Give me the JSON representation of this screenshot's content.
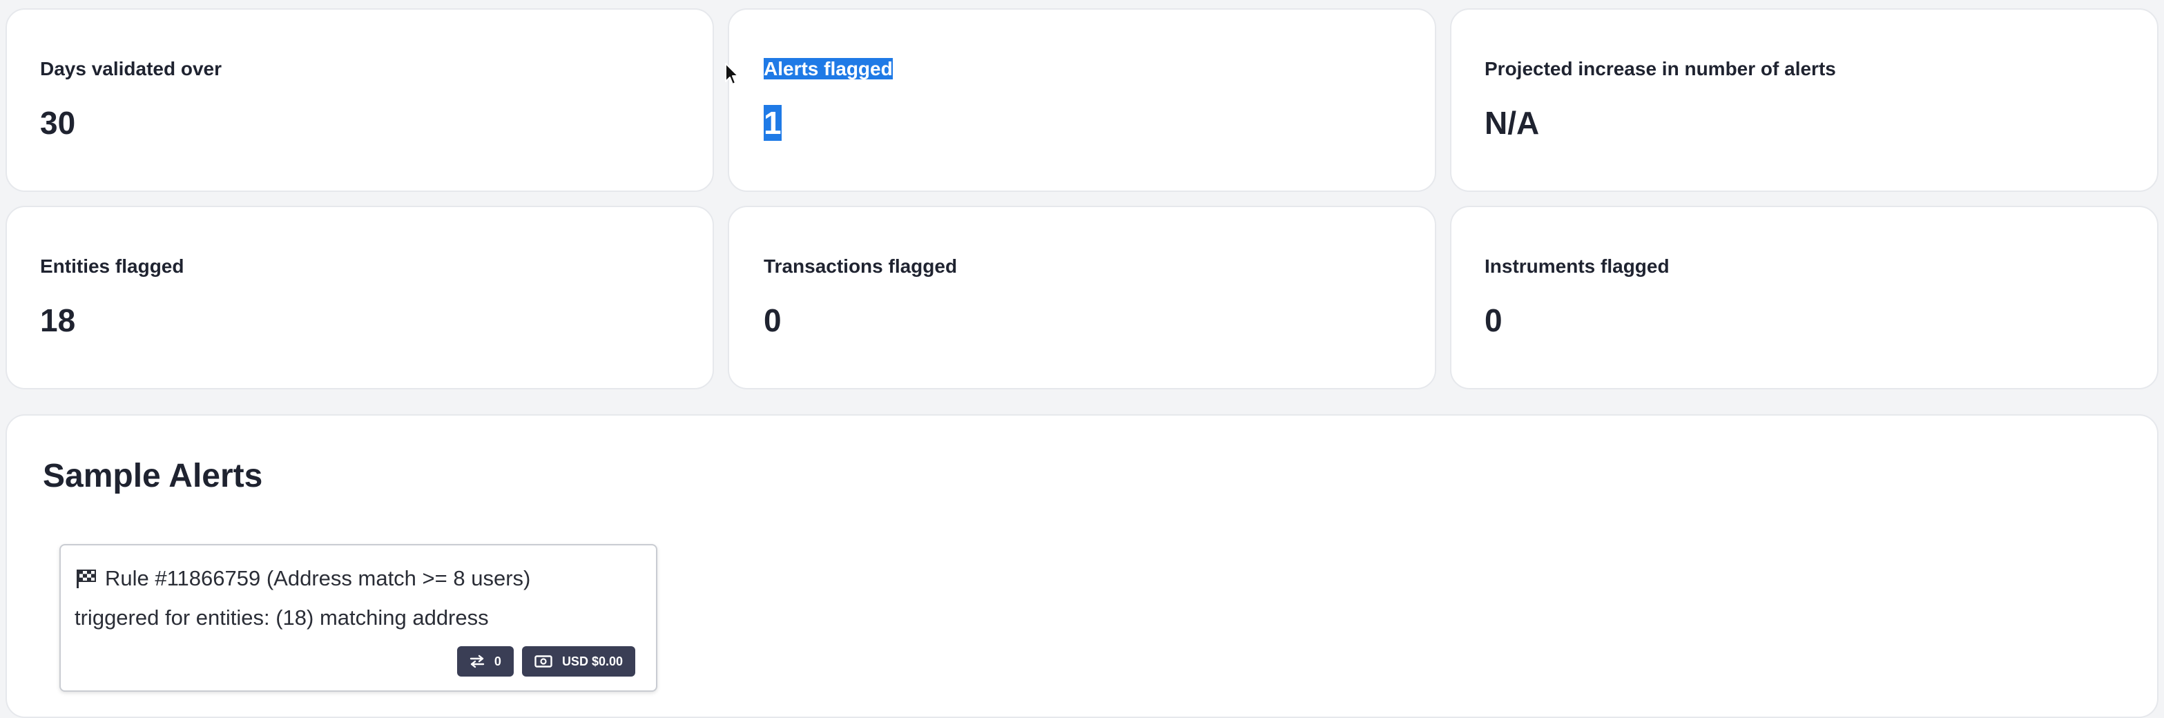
{
  "stats": [
    {
      "label": "Days validated over",
      "value": "30"
    },
    {
      "label": "Alerts flagged",
      "value": "1"
    },
    {
      "label": "Projected increase in number of alerts",
      "value": "N/A"
    },
    {
      "label": "Entities flagged",
      "value": "18"
    },
    {
      "label": "Transactions flagged",
      "value": "0"
    },
    {
      "label": "Instruments flagged",
      "value": "0"
    }
  ],
  "sample_alerts": {
    "title": "Sample Alerts",
    "alerts": [
      {
        "icon": "checkered-flag-icon",
        "rule_text": "Rule #11866759 (Address match >= 8 users)",
        "trigger_text": "triggered for entities: (18) matching address",
        "transfer_count": "0",
        "amount": "USD $0.00"
      }
    ]
  },
  "colors": {
    "background": "#f3f4f6",
    "card": "#ffffff",
    "text_selection": "#1f7ae6",
    "badge": "#3a3e55"
  }
}
